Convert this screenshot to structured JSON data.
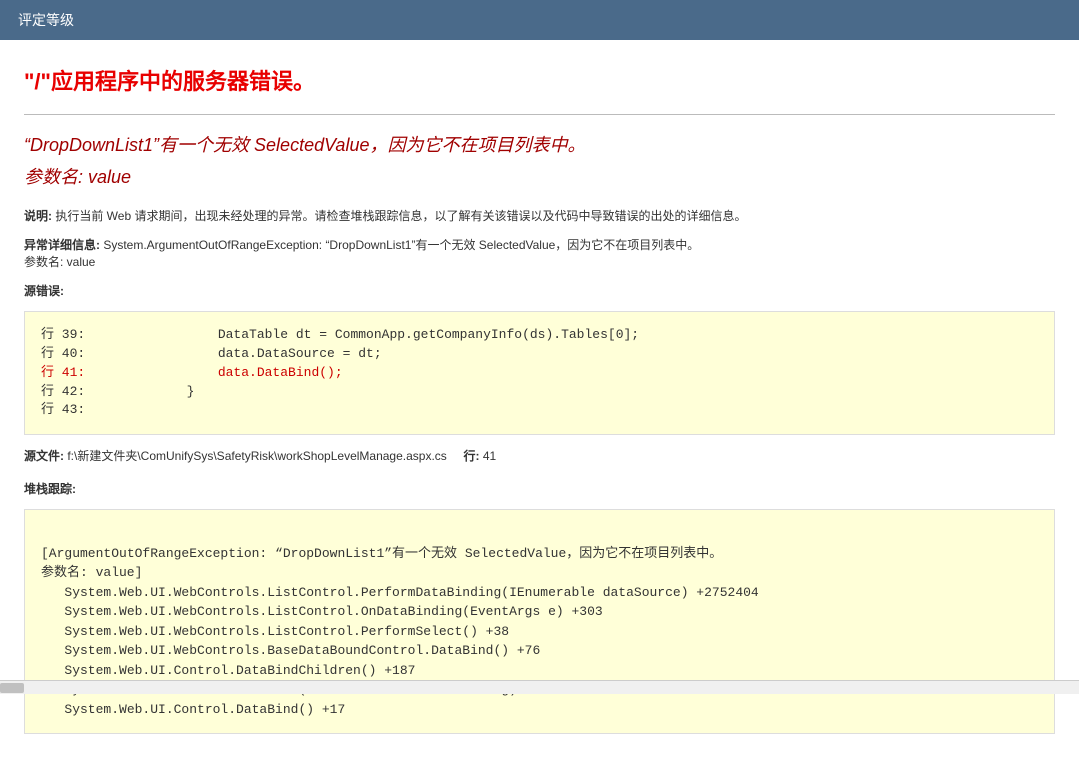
{
  "topbar": {
    "title": "评定等级"
  },
  "error": {
    "app_title": "\"/\"应用程序中的服务器错误。",
    "subtitle_line1": "“DropDownList1”有一个无效 SelectedValue，因为它不在项目列表中。",
    "subtitle_line2": "参数名: value",
    "description_label": "说明:",
    "description_text": " 执行当前 Web 请求期间，出现未经处理的异常。请检查堆栈跟踪信息，以了解有关该错误以及代码中导致错误的出处的详细信息。",
    "exception_label": "异常详细信息:",
    "exception_text": " System.ArgumentOutOfRangeException: “DropDownList1”有一个无效 SelectedValue，因为它不在项目列表中。",
    "exception_param": "参数名: value",
    "source_error_label": "源错误:",
    "code_lines": {
      "l39": "行 39:                 DataTable dt = CommonApp.getCompanyInfo(ds).Tables[0];",
      "l40": "行 40:                 data.DataSource = dt;",
      "l41": "行 41:                 data.DataBind();",
      "l42": "行 42:             }",
      "l43": "行 43: "
    },
    "source_file_label": "源文件:",
    "source_file": " f:\\新建文件夹\\ComUnifySys\\SafetyRisk\\workShopLevelManage.aspx.cs",
    "line_label": "行:",
    "line_no": " 41",
    "stack_label": "堆栈跟踪:",
    "stack": "\n[ArgumentOutOfRangeException: “DropDownList1”有一个无效 SelectedValue，因为它不在项目列表中。\n参数名: value]\n   System.Web.UI.WebControls.ListControl.PerformDataBinding(IEnumerable dataSource) +2752404\n   System.Web.UI.WebControls.ListControl.OnDataBinding(EventArgs e) +303\n   System.Web.UI.WebControls.ListControl.PerformSelect() +38\n   System.Web.UI.WebControls.BaseDataBoundControl.DataBind() +76\n   System.Web.UI.Control.DataBindChildren() +187\n   System.Web.UI.Control.DataBind(Boolean raiseOnDataBinding) +164\n   System.Web.UI.Control.DataBind() +17"
  }
}
